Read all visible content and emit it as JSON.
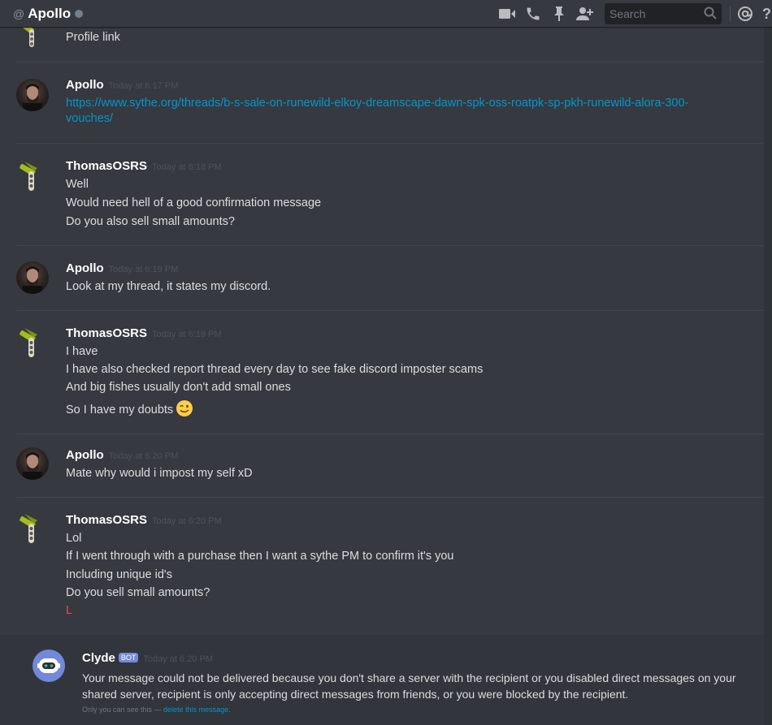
{
  "header": {
    "at_symbol": "@",
    "title": "Apollo",
    "search_placeholder": "Search",
    "icons": [
      "video-call-icon",
      "voice-call-icon",
      "pin-icon",
      "add-friend-icon",
      "search-icon",
      "mention-icon",
      "help-icon"
    ]
  },
  "messages": [
    {
      "author": "",
      "timestamp": "",
      "lines": [
        "Profile link"
      ]
    },
    {
      "author": "Apollo",
      "timestamp": "Today at 6:17 PM",
      "lines": [
        "https://www.sythe.org/threads/b-s-sale-on-runewild-elkoy-dreamscape-dawn-spk-oss-roatpk-sp-pkh-runewild-alora-300-",
        "vouches/"
      ]
    },
    {
      "author": "ThomasOSRS",
      "timestamp": "Today at 6:18 PM",
      "lines": [
        "Well",
        "Would need hell of a good confirmation message",
        "Do you also sell small amounts?"
      ]
    },
    {
      "author": "Apollo",
      "timestamp": "Today at 6:19 PM",
      "lines": [
        "Look at my thread, it states my discord."
      ]
    },
    {
      "author": "ThomasOSRS",
      "timestamp": "Today at 6:19 PM",
      "lines": [
        "I have",
        "I have also checked report thread every day to see fake discord imposter scams",
        "And big fishes usually don't add small ones",
        "So I have my doubts"
      ]
    },
    {
      "author": "Apollo",
      "timestamp": "Today at 6:20 PM",
      "lines": [
        "Mate why would i impost my self xD"
      ]
    },
    {
      "author": "ThomasOSRS",
      "timestamp": "Today at 6:20 PM",
      "lines": [
        "Lol",
        "If I went through with a purchase then I want a sythe PM to confirm it's you",
        "Including unique id's",
        "Do you sell small amounts?",
        "L"
      ]
    }
  ],
  "clyde": {
    "author": "Clyde",
    "bot_tag": "BOT",
    "timestamp": "Today at 6:20 PM",
    "text": "Your message could not be delivered because you don't share a server with the recipient or you disabled direct messages on your shared server, recipient is only accepting direct messages from friends, or you were blocked by the recipient.",
    "note_prefix": "Only you can see this — ",
    "note_link": "delete this message",
    "note_suffix": "."
  },
  "colors": {
    "background": "#36393f",
    "link": "#0096cf",
    "timestamp": "#4e5259",
    "bot_tag": "#7289da",
    "error_red": "#f04747"
  }
}
